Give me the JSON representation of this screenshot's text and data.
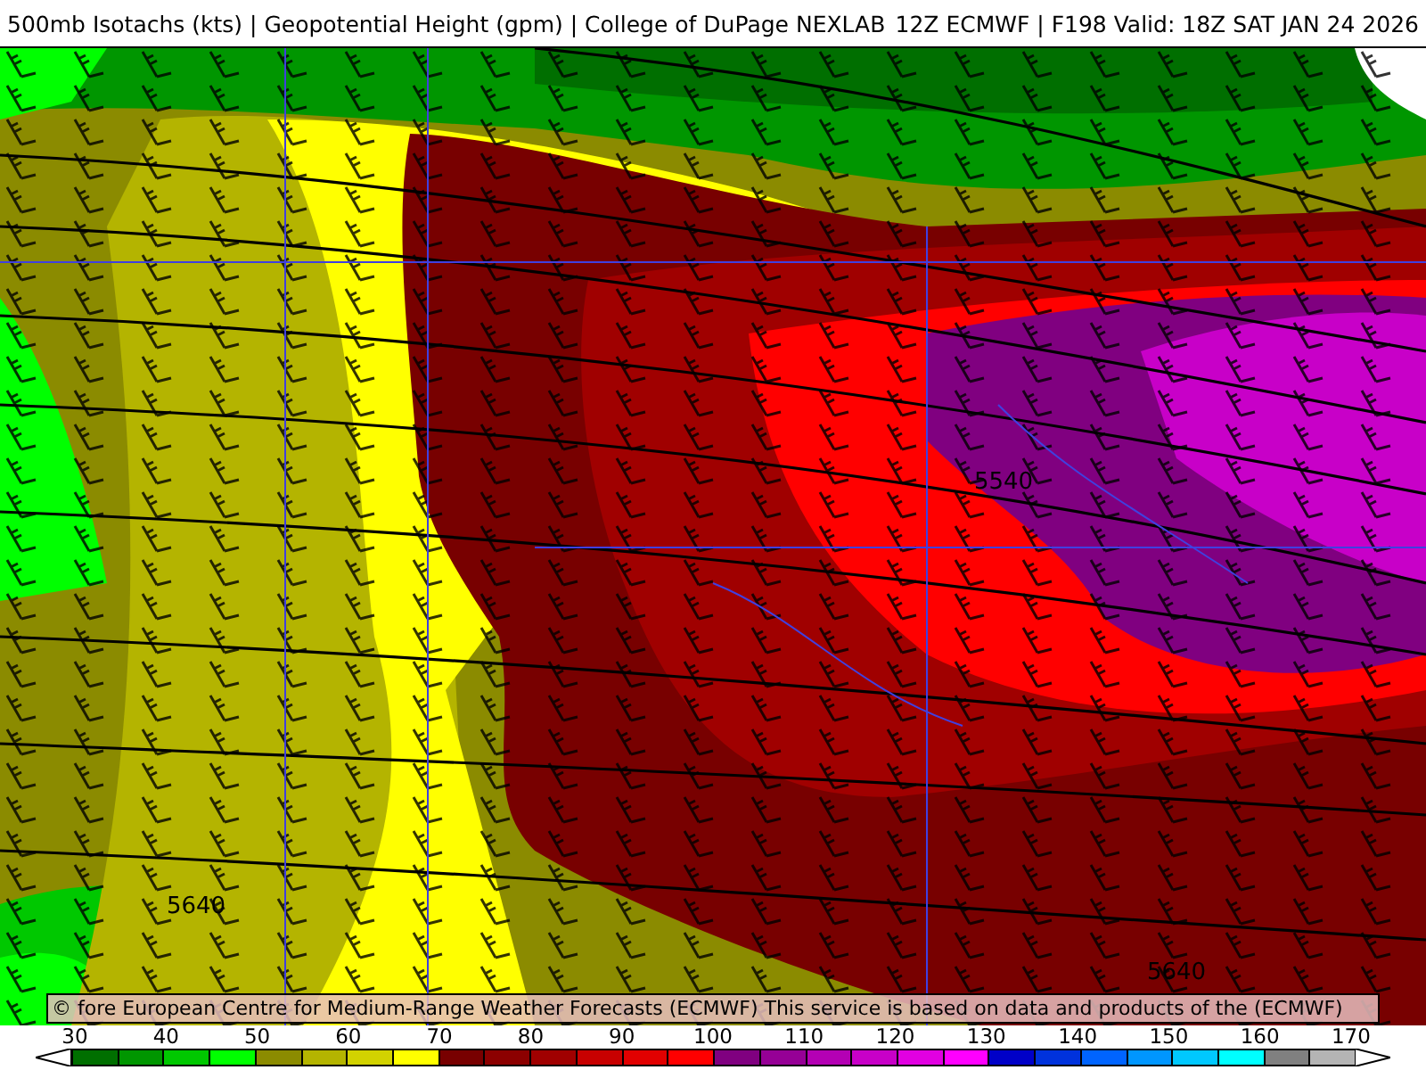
{
  "title": {
    "left": "500mb Isotachs (kts) | Geopotential Height (gpm) | College of DuPage NEXLAB",
    "right": "12Z ECMWF | F198 Valid: 18Z SAT JAN 24 2026"
  },
  "map": {
    "contour_labels": [
      "5540",
      "5640",
      "5640"
    ],
    "credit": "© fore European Centre for Medium-Range Weather Forecasts (ECMWF)  This service is based on data and products of the (ECMWF)"
  },
  "legend": {
    "bins": [
      {
        "color": "#006f00"
      },
      {
        "color": "#009600"
      },
      {
        "color": "#00c800"
      },
      {
        "color": "#00ff00"
      },
      {
        "color": "#8b8b00"
      },
      {
        "color": "#b4b400"
      },
      {
        "color": "#d2d200"
      },
      {
        "color": "#ffff00"
      },
      {
        "color": "#780000"
      },
      {
        "color": "#8c0000"
      },
      {
        "color": "#a00000"
      },
      {
        "color": "#c80000"
      },
      {
        "color": "#e10000"
      },
      {
        "color": "#ff0000"
      },
      {
        "color": "#800080"
      },
      {
        "color": "#960096"
      },
      {
        "color": "#b400b4"
      },
      {
        "color": "#c800c8"
      },
      {
        "color": "#e100e1"
      },
      {
        "color": "#ff00ff"
      },
      {
        "color": "#0000c8"
      },
      {
        "color": "#0032dc"
      },
      {
        "color": "#0064ff"
      },
      {
        "color": "#0096ff"
      },
      {
        "color": "#00c8ff"
      },
      {
        "color": "#00ffff"
      },
      {
        "color": "#808080"
      },
      {
        "color": "#b4b4b4"
      }
    ],
    "labels": [
      "30",
      "40",
      "50",
      "60",
      "70",
      "80",
      "90",
      "100",
      "110",
      "120",
      "130",
      "140",
      "150",
      "160",
      "170"
    ]
  }
}
